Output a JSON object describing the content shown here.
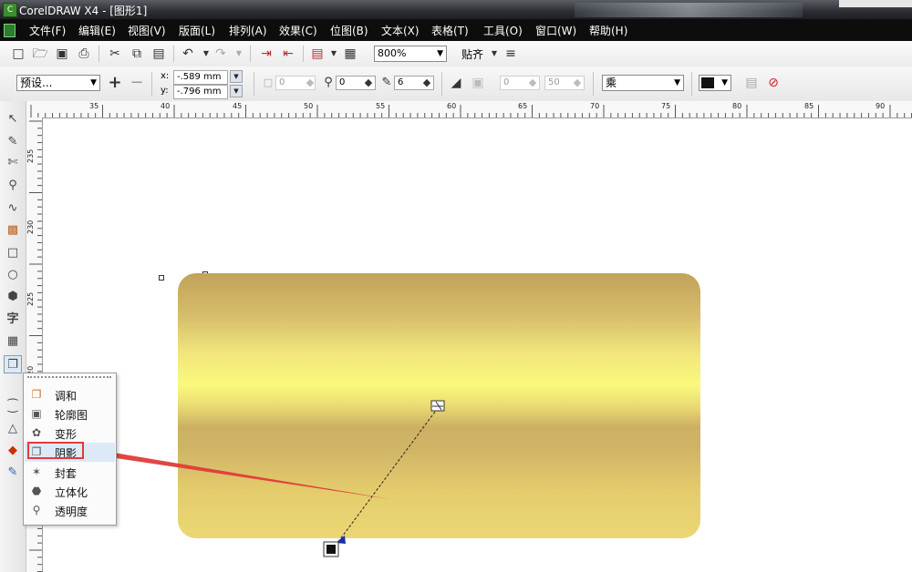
{
  "window": {
    "title": "CorelDRAW X4 - [图形1]"
  },
  "menu": [
    "文件(F)",
    "编辑(E)",
    "视图(V)",
    "版面(L)",
    "排列(A)",
    "效果(C)",
    "位图(B)",
    "文本(X)",
    "表格(T)",
    "工具(O)",
    "窗口(W)",
    "帮助(H)"
  ],
  "toolbar": {
    "zoom": "800%",
    "snap_label": "贴齐"
  },
  "property_bar": {
    "preset": "预设...",
    "x_label": "x:",
    "x_value": "-.589 mm",
    "y_label": "y:",
    "y_value": "-.796 mm",
    "opacity_value": "0",
    "feather_value": "6",
    "transparency_field": "0",
    "direction_field": "0",
    "fade_field": "50",
    "blend_mode": "乘"
  },
  "ruler": {
    "top": [
      "35",
      "40",
      "45",
      "50",
      "55",
      "60",
      "65",
      "70",
      "75",
      "80",
      "85",
      "90"
    ],
    "left": [
      "235",
      "230",
      "225",
      "20"
    ]
  },
  "toolbox_icons": [
    "pick-tool-icon",
    "shape-tool-icon",
    "crop-tool-icon",
    "zoom-tool-icon",
    "freehand-tool-icon",
    "smart-fill-tool-icon",
    "rectangle-tool-icon",
    "ellipse-tool-icon",
    "polygon-tool-icon",
    "text-tool-icon",
    "table-tool-icon",
    "interactive-tool-icon",
    "eyedropper-tool-icon",
    "outline-tool-icon",
    "fill-tool-icon",
    "interactive-fill-tool-icon"
  ],
  "flyout": {
    "items": [
      "调和",
      "轮廓图",
      "变形",
      "阴影",
      "封套",
      "立体化",
      "透明度"
    ],
    "selected": "阴影"
  },
  "colors": {
    "accent_red": "#e23b3b",
    "gold_light": "#fbf97c",
    "gold_dark": "#c2a25a"
  }
}
